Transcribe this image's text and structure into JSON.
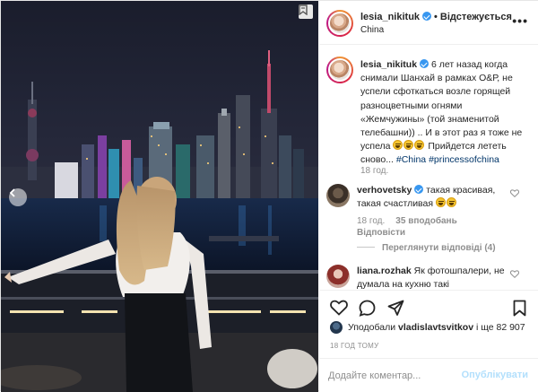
{
  "post": {
    "username": "lesia_nikituk",
    "follow_status": "Відстежується",
    "location": "China",
    "caption": {
      "username": "lesia_nikituk",
      "text_1": "6 лет назад когда снимали Шанхай в рамках О&Р, не успели сфоткаться возле горящей разноцветными огнями «Жемчужины» (той знаменитой телебашни)) .. И в этот раз я тоже не успела",
      "text_2": "Прийдется лететь сново...",
      "tags": [
        "#China",
        "#princessofchina"
      ],
      "time": "18 год."
    },
    "comments": [
      {
        "username": "verhovetsky",
        "text": "такая красивая, такая счастливая",
        "time": "18 год.",
        "likes": "35 вподобань",
        "reply": "Відповісти",
        "view_replies": "Переглянути відповіді (4)"
      },
      {
        "username": "liana.rozhak",
        "text": "Як фотошпалери, не думала на кухню такі"
      }
    ],
    "likes": {
      "prefix": "Уподобали",
      "user": "vladislavtsvitkov",
      "suffix": "і ще 82 907"
    },
    "date": "18 ГОД ТОМУ",
    "add_comment_placeholder": "Додайте коментар...",
    "publish_label": "Опублікувати",
    "more_label": "•••"
  },
  "icons": {
    "save_corner": "bookmark-icon",
    "carousel_prev": "chevron-left-icon",
    "like": "heart-icon",
    "comment": "speech-bubble-icon",
    "share": "paper-plane-icon",
    "save": "bookmark-icon"
  },
  "colors": {
    "link": "#003569",
    "verified": "#3897f0",
    "publish_disabled": "#b2dffc",
    "muted": "#8e8e8e"
  }
}
